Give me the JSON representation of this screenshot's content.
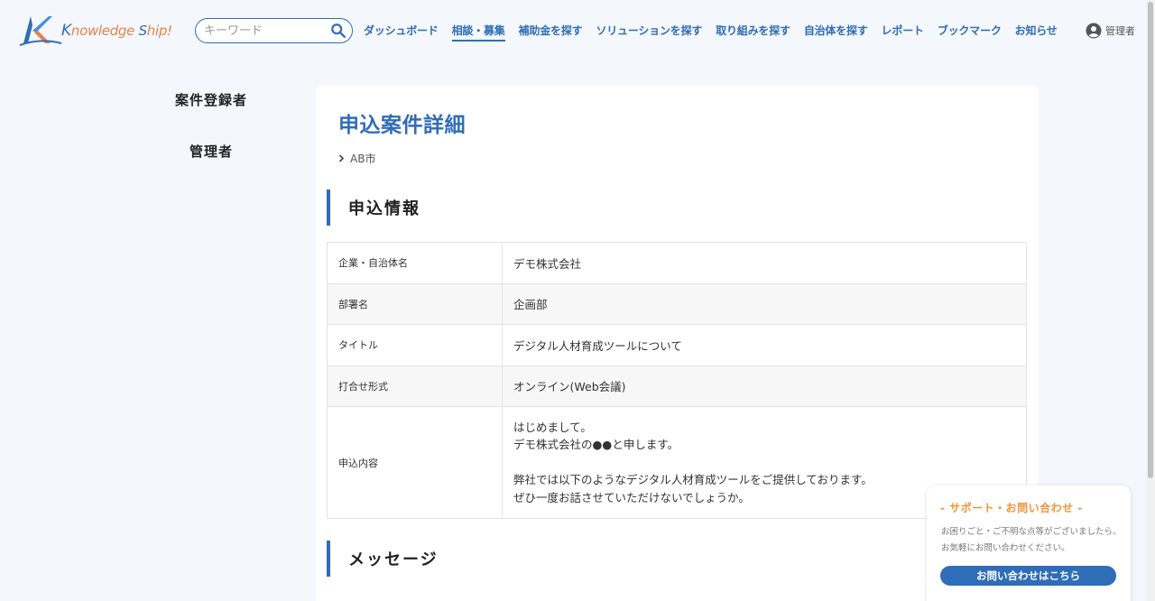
{
  "header": {
    "logo_text_k": "K",
    "logo_text_rest": "nowledge ",
    "logo_text_s": "S",
    "logo_text_end": "hip!",
    "search": {
      "placeholder": "キーワード",
      "value": ""
    },
    "nav": [
      {
        "label": "ダッシュボード",
        "active": false
      },
      {
        "label": "相談・募集",
        "active": true
      },
      {
        "label": "補助金を探す",
        "active": false
      },
      {
        "label": "ソリューションを探す",
        "active": false
      },
      {
        "label": "取り組みを探す",
        "active": false
      },
      {
        "label": "自治体を探す",
        "active": false
      },
      {
        "label": "レポート",
        "active": false
      },
      {
        "label": "ブックマーク",
        "active": false
      },
      {
        "label": "お知らせ",
        "active": false
      }
    ],
    "user_name": "管理者"
  },
  "sidebar": {
    "items": [
      {
        "label": "案件登録者"
      },
      {
        "label": "管理者"
      }
    ]
  },
  "main": {
    "title": "申込案件詳細",
    "breadcrumb": "AB市",
    "section_info": "申込情報",
    "rows": [
      {
        "key": "企業・自治体名",
        "value": "デモ株式会社"
      },
      {
        "key": "部署名",
        "value": "企画部"
      },
      {
        "key": "タイトル",
        "value": "デジタル人材育成ツールについて"
      },
      {
        "key": "打合せ形式",
        "value": "オンライン(Web会議)"
      }
    ],
    "message_row": {
      "key": "申込内容",
      "lines": [
        "はじめまして。",
        "デモ株式会社の●●と申します。",
        "",
        "弊社では以下のようなデジタル人材育成ツールをご提供しております。",
        "ぜひ一度お話させていただけないでしょうか。"
      ]
    },
    "section_message": "メッセージ"
  },
  "support": {
    "title": "- サポート・お問い合わせ -",
    "body_line1": "お困りごと・ご不明な点等がございましたら、",
    "body_line2": "お気軽にお問い合わせください。",
    "button": "お問い合わせはこちら"
  },
  "colors": {
    "accent": "#2f6db8",
    "support_title": "#f0953a",
    "background": "#f4f7fb"
  }
}
